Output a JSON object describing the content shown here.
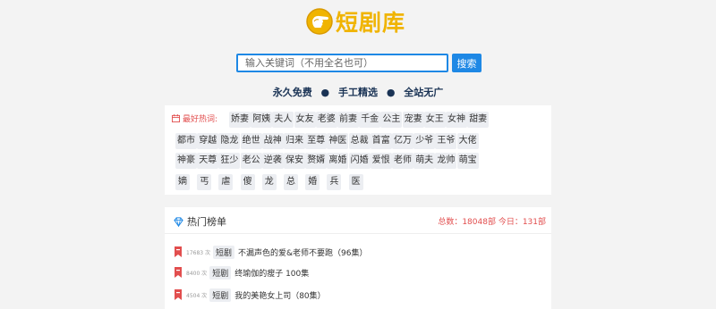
{
  "logo": {
    "text": "短剧库"
  },
  "search": {
    "placeholder": "输入关键词（不用全名也可）",
    "button_label": "搜索"
  },
  "features": [
    "永久免费",
    "手工精选",
    "全站无广"
  ],
  "hot_tags": {
    "label": "最好热词:",
    "rows": [
      [
        "娇妻",
        "阿姨",
        "夫人",
        "女友",
        "老婆",
        "前妻",
        "千金",
        "公主",
        "宠妻",
        "女王",
        "女神",
        "甜妻"
      ],
      [
        "都市",
        "穿越",
        "隐龙",
        "绝世",
        "战神",
        "归来",
        "至尊",
        "神医",
        "总裁",
        "首富",
        "亿万",
        "少爷",
        "王爷",
        "大佬"
      ],
      [
        "神豪",
        "天尊",
        "狂少",
        "老公",
        "逆袭",
        "保安",
        "赘婿",
        "离婚",
        "闪婚",
        "爱恨",
        "老师",
        "萌夫",
        "龙帅",
        "萌宝"
      ],
      [
        "嫡",
        "丐",
        "虐",
        "傻",
        "龙",
        "总",
        "婚",
        "兵",
        "医"
      ]
    ]
  },
  "rank": {
    "title": "热门榜单",
    "stats": "总数：18048部 今日：131部",
    "items": [
      {
        "count": "17683 次",
        "tag": "短剧",
        "name": "不漏声色的爱&老师不要跑（96集）"
      },
      {
        "count": "8400 次",
        "tag": "短剧",
        "name": "终瑜伽的瘦子 100集"
      },
      {
        "count": "4504 次",
        "tag": "短剧",
        "name": "我的美艳女上司（80集）"
      }
    ]
  },
  "colors": {
    "accent": "#1e88e5",
    "logo": "#f0b400",
    "hot": "#e24e4e",
    "navy": "#1a3355"
  }
}
